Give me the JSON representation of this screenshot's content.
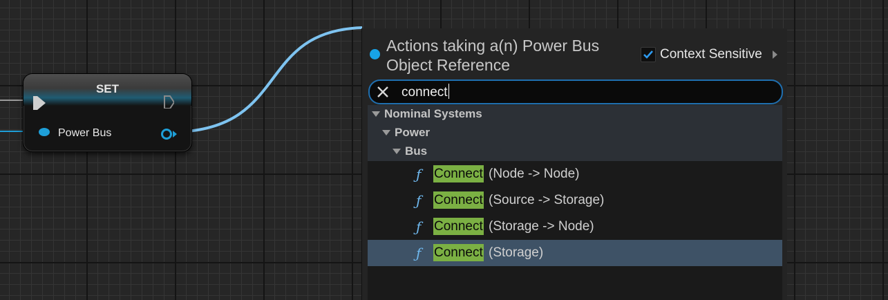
{
  "node": {
    "title": "SET",
    "pin_label": "Power Bus",
    "colors": {
      "pin": "#1e9fd8",
      "header_accent": "#1f5c73"
    }
  },
  "menu": {
    "title": "Actions taking a(n) Power Bus Object Reference",
    "context_sensitive_label": "Context Sensitive",
    "context_sensitive_checked": true,
    "search": {
      "value": "connect",
      "clear_icon": "close-icon"
    },
    "categories": [
      {
        "label": "Nominal Systems",
        "depth": 0
      },
      {
        "label": "Power",
        "depth": 1
      },
      {
        "label": "Bus",
        "depth": 2
      }
    ],
    "items": [
      {
        "icon": "function-icon",
        "match": "Connect",
        "rest": "(Node -> Node)",
        "selected": false
      },
      {
        "icon": "function-icon",
        "match": "Connect",
        "rest": "(Source -> Storage)",
        "selected": false
      },
      {
        "icon": "function-icon",
        "match": "Connect",
        "rest": "(Storage -> Node)",
        "selected": false
      },
      {
        "icon": "function-icon",
        "match": "Connect",
        "rest": "(Storage)",
        "selected": true
      }
    ],
    "colors": {
      "highlight": "#7bb043",
      "selection": "#3e5266",
      "accent": "#1f6fb0"
    }
  }
}
